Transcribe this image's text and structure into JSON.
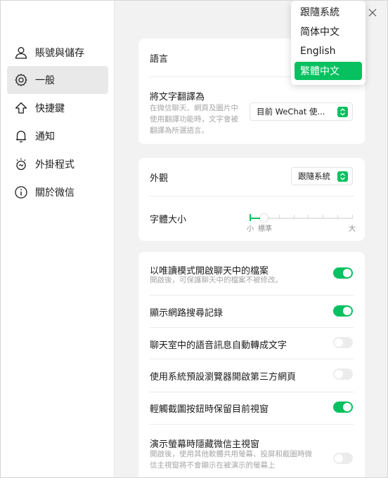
{
  "sidebar": {
    "items": [
      {
        "label": "賬號與儲存",
        "icon": "user-icon"
      },
      {
        "label": "一般",
        "icon": "gear-icon"
      },
      {
        "label": "快捷鍵",
        "icon": "shortcut-arrow-icon"
      },
      {
        "label": "通知",
        "icon": "bell-icon"
      },
      {
        "label": "外掛程式",
        "icon": "plugin-icon"
      },
      {
        "label": "關於微信",
        "icon": "info-icon"
      }
    ],
    "active_index": 1
  },
  "language_card": {
    "language_label": "語言",
    "translate_label": "將文字翻譯為",
    "translate_desc": "在微信聊天、網頁及圖片中使用翻譯功能時，文字會被翻譯為所選語言。",
    "translate_value": "目前 WeChat 使..."
  },
  "appearance_card": {
    "appearance_label": "外觀",
    "appearance_value": "跟隨系統",
    "font_size_label": "字體大小",
    "scale_small": "小",
    "scale_standard": "標準",
    "scale_large": "大",
    "font_size_level": 1,
    "font_size_steps": 8
  },
  "options_card": {
    "rows": [
      {
        "label": "以唯讀模式開啟聊天中的檔案",
        "desc": "開啟後，可保護聊天中的檔案不被修改。",
        "on": true
      },
      {
        "label": "顯示網路搜尋記錄",
        "desc": "",
        "on": true
      },
      {
        "label": "聊天室中的語音訊息自動轉成文字",
        "desc": "",
        "on": false
      },
      {
        "label": "使用系統預設瀏覽器開啟第三方網頁",
        "desc": "",
        "on": false
      },
      {
        "label": "輕觸截圖按鈕時保留目前視窗",
        "desc": "",
        "on": true
      },
      {
        "label": "演示螢幕時隱藏微信主視窗",
        "desc": "開啟後，使用其他軟體共用螢幕、投屏和截圖時微信主視窗將不會顯示在被演示的螢幕上",
        "on": false
      }
    ]
  },
  "language_dropdown": {
    "options": [
      "跟隨系統",
      "简体中文",
      "English",
      "繁體中文"
    ],
    "selected_index": 3
  },
  "colors": {
    "accent": "#07c160",
    "toggle_off": "#ececec",
    "background": "#f2f2f2"
  }
}
